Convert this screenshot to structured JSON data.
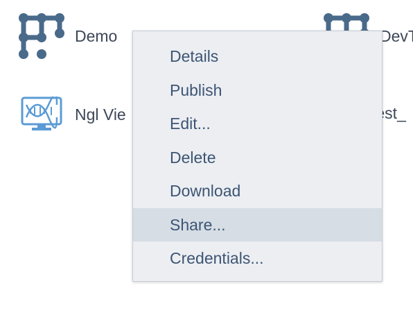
{
  "apps": {
    "demo": {
      "label": "Demo",
      "icon": "network-graph-icon"
    },
    "dev": {
      "label": "DevT",
      "icon": "network-graph-icon"
    },
    "ngl": {
      "label": "Ngl Vie",
      "icon": "dna-monitor-icon"
    },
    "test": {
      "label": "test_"
    }
  },
  "context_menu": {
    "items": [
      {
        "label": "Details"
      },
      {
        "label": "Publish"
      },
      {
        "label": "Edit..."
      },
      {
        "label": "Delete"
      },
      {
        "label": "Download"
      },
      {
        "label": "Share...",
        "state": "hovered"
      },
      {
        "label": "Credentials..."
      }
    ]
  },
  "colors": {
    "icon_blue": "#4a6a8a",
    "dna_blue": "#5b9bd5",
    "menu_bg": "#eceef2",
    "menu_hover": "#d6dde5",
    "menu_text": "#3d5573",
    "label_text": "#3c4757"
  }
}
